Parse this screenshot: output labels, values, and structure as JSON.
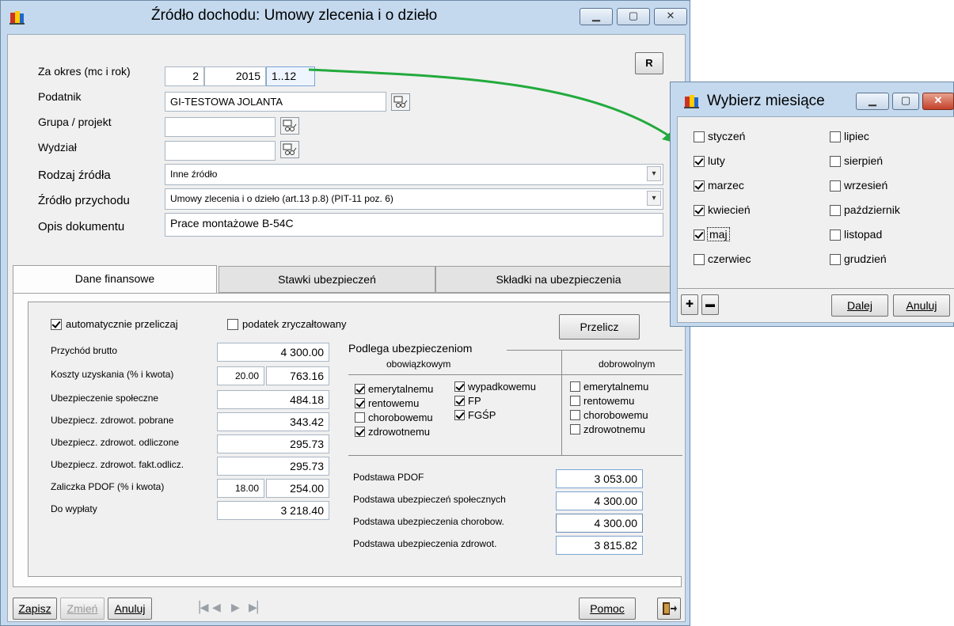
{
  "main_window": {
    "title": "Źródło dochodu: Umowy zlecenia i o dzieło",
    "r_button": "R",
    "labels": {
      "period": "Za okres (mc i rok)",
      "taxpayer": "Podatnik",
      "group": "Grupa / projekt",
      "department": "Wydział",
      "source_type": "Rodzaj źródła",
      "income_source": "Źródło przychodu",
      "description": "Opis dokumentu"
    },
    "values": {
      "month": "2",
      "year": "2015",
      "months_range": "1..12",
      "taxpayer": "GI-TESTOWA JOLANTA",
      "group": "",
      "department": "",
      "source_type": "Inne źródło",
      "income_source": "Umowy zlecenia i o dzieło (art.13 p.8) (PIT-11 poz. 6)",
      "description": "Prace montażowe B-54C"
    },
    "tabs": [
      "Dane finansowe",
      "Stawki ubezpieczeń",
      "Składki na ubezpieczenia"
    ],
    "finance": {
      "auto_calc": "automatycznie przeliczaj",
      "flat_tax": "podatek zryczałtowany",
      "recalc_button": "Przelicz",
      "rows": [
        {
          "label": "Przychód brutto",
          "pct": "",
          "value": "4 300.00"
        },
        {
          "label": "Koszty uzyskania (% i kwota)",
          "pct": "20.00",
          "value": "763.16"
        },
        {
          "label": "Ubezpieczenie społeczne",
          "pct": "",
          "value": "484.18"
        },
        {
          "label": "Ubezpiecz. zdrowot. pobrane",
          "pct": "",
          "value": "343.42"
        },
        {
          "label": "Ubezpiecz. zdrowot. odliczone",
          "pct": "",
          "value": "295.73"
        },
        {
          "label": "Ubezpiecz. zdrowot. fakt.odlicz.",
          "pct": "",
          "value": "295.73"
        },
        {
          "label": "Zaliczka PDOF (% i kwota)",
          "pct": "18.00",
          "value": "254.00"
        },
        {
          "label": "Do wypłaty",
          "pct": "",
          "value": "3 218.40"
        }
      ],
      "insurance_title": "Podlega ubezpieczeniom",
      "mandatory_header": "obowiązkowym",
      "voluntary_header": "dobrowolnym",
      "mandatory": [
        {
          "label": "emerytalnemu",
          "checked": true
        },
        {
          "label": "rentowemu",
          "checked": true
        },
        {
          "label": "chorobowemu",
          "checked": false
        },
        {
          "label": "zdrowotnemu",
          "checked": true
        },
        {
          "label": "wypadkowemu",
          "checked": true
        },
        {
          "label": "FP",
          "checked": true
        },
        {
          "label": "FGŚP",
          "checked": true
        }
      ],
      "voluntary": [
        {
          "label": "emerytalnemu",
          "checked": false
        },
        {
          "label": "rentowemu",
          "checked": false
        },
        {
          "label": "chorobowemu",
          "checked": false
        },
        {
          "label": "zdrowotnemu",
          "checked": false
        }
      ],
      "bases": [
        {
          "label": "Podstawa PDOF",
          "value": "3 053.00"
        },
        {
          "label": "Podstawa ubezpieczeń społecznych",
          "value": "4 300.00"
        },
        {
          "label": "Podstawa ubezpieczenia chorobow.",
          "value": "4 300.00"
        },
        {
          "label": "Podstawa ubezpieczenia zdrowot.",
          "value": "3 815.82"
        }
      ]
    },
    "bottom": {
      "save": "Zapisz",
      "change": "Zmień",
      "cancel": "Anuluj",
      "help": "Pomoc"
    }
  },
  "month_dialog": {
    "title": "Wybierz miesiące",
    "months": [
      {
        "label": "styczeń",
        "checked": false
      },
      {
        "label": "luty",
        "checked": true
      },
      {
        "label": "marzec",
        "checked": true
      },
      {
        "label": "kwiecień",
        "checked": true
      },
      {
        "label": "maj",
        "checked": true
      },
      {
        "label": "czerwiec",
        "checked": false
      },
      {
        "label": "lipiec",
        "checked": false
      },
      {
        "label": "sierpień",
        "checked": false
      },
      {
        "label": "wrzesień",
        "checked": false
      },
      {
        "label": "październik",
        "checked": false
      },
      {
        "label": "listopad",
        "checked": false
      },
      {
        "label": "grudzień",
        "checked": false
      }
    ],
    "next_button": "Dalej",
    "cancel_button": "Anuluj"
  },
  "colors": {
    "frame": "#c4d9ee",
    "client": "#f0f0f0",
    "arrow": "#22aa3c",
    "close": "#c4412a"
  }
}
